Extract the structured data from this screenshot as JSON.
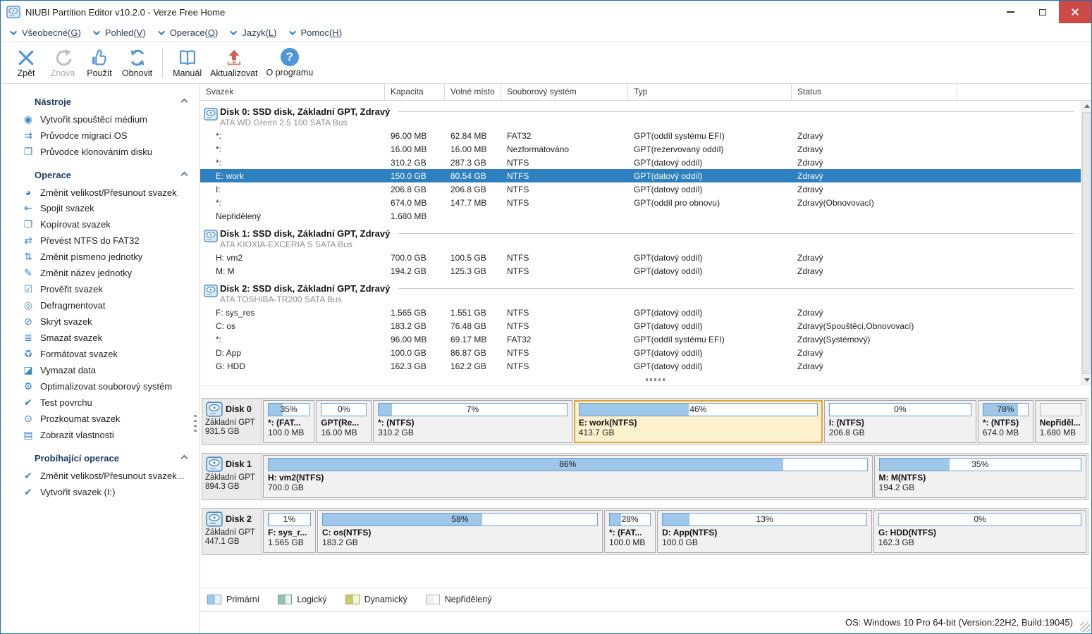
{
  "window": {
    "title": "NIUBI Partition Editor v10.2.0 - Verze Free Home"
  },
  "menu": {
    "items": [
      {
        "pre": "Všeobecné(",
        "key": "G",
        "post": ")"
      },
      {
        "pre": "Pohled(",
        "key": "V",
        "post": ")"
      },
      {
        "pre": "Operace(",
        "key": "O",
        "post": ")"
      },
      {
        "pre": "Jazyk(",
        "key": "L",
        "post": ")"
      },
      {
        "pre": "Pomoc(",
        "key": "H",
        "post": ")"
      }
    ]
  },
  "toolbar": {
    "about_glyph": "?",
    "buttons": [
      {
        "label": "Zpět"
      },
      {
        "label": "Znova"
      },
      {
        "label": "Použít"
      },
      {
        "label": "Obnovit"
      },
      {
        "label": "Manuál"
      },
      {
        "label": "Aktualizovat"
      },
      {
        "label": "O programu"
      }
    ]
  },
  "sidebar": {
    "sections": [
      {
        "title": "Nástroje",
        "items": [
          {
            "label": "Vytvořit spouštěcí médium",
            "icon": "◉"
          },
          {
            "label": "Průvodce migrací OS",
            "icon": "⇉"
          },
          {
            "label": "Průvodce klonováním disku",
            "icon": "❐"
          }
        ]
      },
      {
        "title": "Operace",
        "items": [
          {
            "label": "Změnit velikost/Přesunout svazek",
            "icon": "◕"
          },
          {
            "label": "Spojit svazek",
            "icon": "⇤"
          },
          {
            "label": "Kopírovat svazek",
            "icon": "❐"
          },
          {
            "label": "Převést NTFS do FAT32",
            "icon": "⇄"
          },
          {
            "label": "Změnit písmeno jednotky",
            "icon": "⇅"
          },
          {
            "label": "Změnit název jednotky",
            "icon": "✎"
          },
          {
            "label": "Prověřit svazek",
            "icon": "☑"
          },
          {
            "label": "Defragmentovat",
            "icon": "◎"
          },
          {
            "label": "Skrýt svazek",
            "icon": "⊘"
          },
          {
            "label": "Smazat svazek",
            "icon": "≣"
          },
          {
            "label": "Formátovat svazek",
            "icon": "♻"
          },
          {
            "label": "Vymazat data",
            "icon": "◪"
          },
          {
            "label": "Optimalizovat souborový systém",
            "icon": "⚙"
          },
          {
            "label": "Test povrchu",
            "icon": "✔"
          },
          {
            "label": "Prozkoumat svazek",
            "icon": "⊙"
          },
          {
            "label": "Zobrazit vlastnosti",
            "icon": "▤"
          }
        ]
      },
      {
        "title": "Probíhající operace",
        "items": [
          {
            "label": "Změnit velikost/Přesunout svazek...",
            "icon": "✔"
          },
          {
            "label": "Vytvořit svazek (I:)",
            "icon": "✔"
          }
        ]
      }
    ]
  },
  "table": {
    "columns": [
      "Svazek",
      "Kapacita",
      "Volné místo",
      "Souborový systém",
      "Typ",
      "Status"
    ],
    "disks": [
      {
        "title": "Disk 0: SSD disk, Základní GPT, Zdravý",
        "subtitle": "ATA WD Green 2.5 100 SATA Bus",
        "rows": [
          {
            "svazek": "*:",
            "kapacita": "96.00 MB",
            "volne": "62.84 MB",
            "fs": "FAT32",
            "typ": "GPT(oddíl systému EFI)",
            "status": "Zdravý"
          },
          {
            "svazek": "*:",
            "kapacita": "16.00 MB",
            "volne": "16.00 MB",
            "fs": "Nezformátováno",
            "typ": "GPT(rezervovaný oddíl)",
            "status": "Zdravý"
          },
          {
            "svazek": "*:",
            "kapacita": "310.2 GB",
            "volne": "287.3 GB",
            "fs": "NTFS",
            "typ": "GPT(datový oddíl)",
            "status": "Zdravý"
          },
          {
            "svazek": "E: work",
            "kapacita": "150.0 GB",
            "volne": "80.54 GB",
            "fs": "NTFS",
            "typ": "GPT(datový oddíl)",
            "status": "Zdravý"
          },
          {
            "svazek": "I:",
            "kapacita": "206.8 GB",
            "volne": "206.8 GB",
            "fs": "NTFS",
            "typ": "GPT(datový oddíl)",
            "status": "Zdravý"
          },
          {
            "svazek": "*:",
            "kapacita": "674.0 MB",
            "volne": "147.7 MB",
            "fs": "NTFS",
            "typ": "GPT(oddíl pro obnovu)",
            "status": "Zdravý(Obnovovací)"
          },
          {
            "svazek": "Nepřidělený",
            "kapacita": "1.680 MB",
            "volne": "",
            "fs": "",
            "typ": "",
            "status": ""
          }
        ]
      },
      {
        "title": "Disk 1: SSD disk, Základní GPT, Zdravý",
        "subtitle": "ATA KIOXIA-EXCERIA S SATA Bus",
        "rows": [
          {
            "svazek": "H: vm2",
            "kapacita": "700.0 GB",
            "volne": "100.5 GB",
            "fs": "NTFS",
            "typ": "GPT(datový oddíl)",
            "status": "Zdravý"
          },
          {
            "svazek": "M: M",
            "kapacita": "194.2 GB",
            "volne": "125.3 GB",
            "fs": "NTFS",
            "typ": "GPT(datový oddíl)",
            "status": "Zdravý"
          }
        ]
      },
      {
        "title": "Disk 2: SSD disk, Základní GPT, Zdravý",
        "subtitle": "ATA TOSHIBA-TR200 SATA Bus",
        "rows": [
          {
            "svazek": "F: sys_res",
            "kapacita": "1.565 GB",
            "volne": "1.551 GB",
            "fs": "NTFS",
            "typ": "GPT(datový oddíl)",
            "status": "Zdravý"
          },
          {
            "svazek": "C: os",
            "kapacita": "183.2 GB",
            "volne": "76.48 GB",
            "fs": "NTFS",
            "typ": "GPT(datový oddíl)",
            "status": "Zdravý(Spouštěcí,Obnovovací)"
          },
          {
            "svazek": "*:",
            "kapacita": "96.00 MB",
            "volne": "69.17 MB",
            "fs": "FAT32",
            "typ": "GPT(oddíl systému EFI)",
            "status": "Zdravý(Systémový)"
          },
          {
            "svazek": "D: App",
            "kapacita": "100.0 GB",
            "volne": "86.87 GB",
            "fs": "NTFS",
            "typ": "GPT(datový oddíl)",
            "status": "Zdravý"
          },
          {
            "svazek": "G: HDD",
            "kapacita": "162.3 GB",
            "volne": "162.2 GB",
            "fs": "NTFS",
            "typ": "GPT(datový oddíl)",
            "status": "Zdravý"
          }
        ]
      }
    ]
  },
  "disk_map": {
    "disks": [
      {
        "name": "Disk 0",
        "scheme": "Základní GPT",
        "size": "931.5 GB",
        "parts": [
          {
            "label": "*: (FAT...",
            "size": "100.0 MB",
            "percent": "35%",
            "fill": "width:35%"
          },
          {
            "label": "GPT(Re...",
            "size": "16.00 MB",
            "percent": "0%",
            "fill": "width:0%"
          },
          {
            "label": "*: (NTFS)",
            "size": "310.2 GB",
            "percent": "7%",
            "fill": "width:7%"
          },
          {
            "label": "E: work(NTFS)",
            "size": "413.7 GB",
            "percent": "46%",
            "fill": "width:46%"
          },
          {
            "label": "I: (NTFS)",
            "size": "206.8 GB",
            "percent": "0%",
            "fill": "width:0%"
          },
          {
            "label": "*: (NTFS)",
            "size": "674.0 MB",
            "percent": "78%",
            "fill": "width:78%"
          },
          {
            "label": "Nepřiděl...",
            "size": "1.680 MB",
            "percent": "",
            "fill": "width:0%"
          }
        ]
      },
      {
        "name": "Disk 1",
        "scheme": "Základní GPT",
        "size": "894.3 GB",
        "parts": [
          {
            "label": "H: vm2(NTFS)",
            "size": "700.0 GB",
            "percent": "86%",
            "fill": "width:86%"
          },
          {
            "label": "M: M(NTFS)",
            "size": "194.2 GB",
            "percent": "35%",
            "fill": "width:35%"
          }
        ]
      },
      {
        "name": "Disk 2",
        "scheme": "Základní GPT",
        "size": "447.1 GB",
        "parts": [
          {
            "label": "F: sys_r...",
            "size": "1.565 GB",
            "percent": "1%",
            "fill": "width:1%"
          },
          {
            "label": "C: os(NTFS)",
            "size": "183.2 GB",
            "percent": "58%",
            "fill": "width:58%"
          },
          {
            "label": "*: (FAT...",
            "size": "100.0 MB",
            "percent": "28%",
            "fill": "width:28%"
          },
          {
            "label": "D: App(NTFS)",
            "size": "100.0 GB",
            "percent": "13%",
            "fill": "width:13%"
          },
          {
            "label": "G: HDD(NTFS)",
            "size": "162.3 GB",
            "percent": "0%",
            "fill": "width:0%"
          }
        ]
      }
    ]
  },
  "legend": {
    "items": [
      {
        "label": "Primární"
      },
      {
        "label": "Logický"
      },
      {
        "label": "Dynamický"
      },
      {
        "label": "Nepřidělený"
      }
    ]
  },
  "statusbar": {
    "os_info": "OS: Windows 10 Pro 64-bit (Version:22H2, Build:19045)"
  },
  "colors": {
    "accent_blue": "#3c87c8",
    "selected_row_bg": "#2e80be",
    "bar_fill": "#9fc7ea",
    "bar_border": "#6f9fcc",
    "selected_part_border": "#e2a33c",
    "selected_part_bg": "#fcf1cd",
    "update_red": "#cf6055",
    "legend_primary": "#9fc7ea",
    "legend_logical": "#96c3ae",
    "legend_dynamic": "#c9cc6d",
    "legend_unallocated": "#ffffff"
  }
}
